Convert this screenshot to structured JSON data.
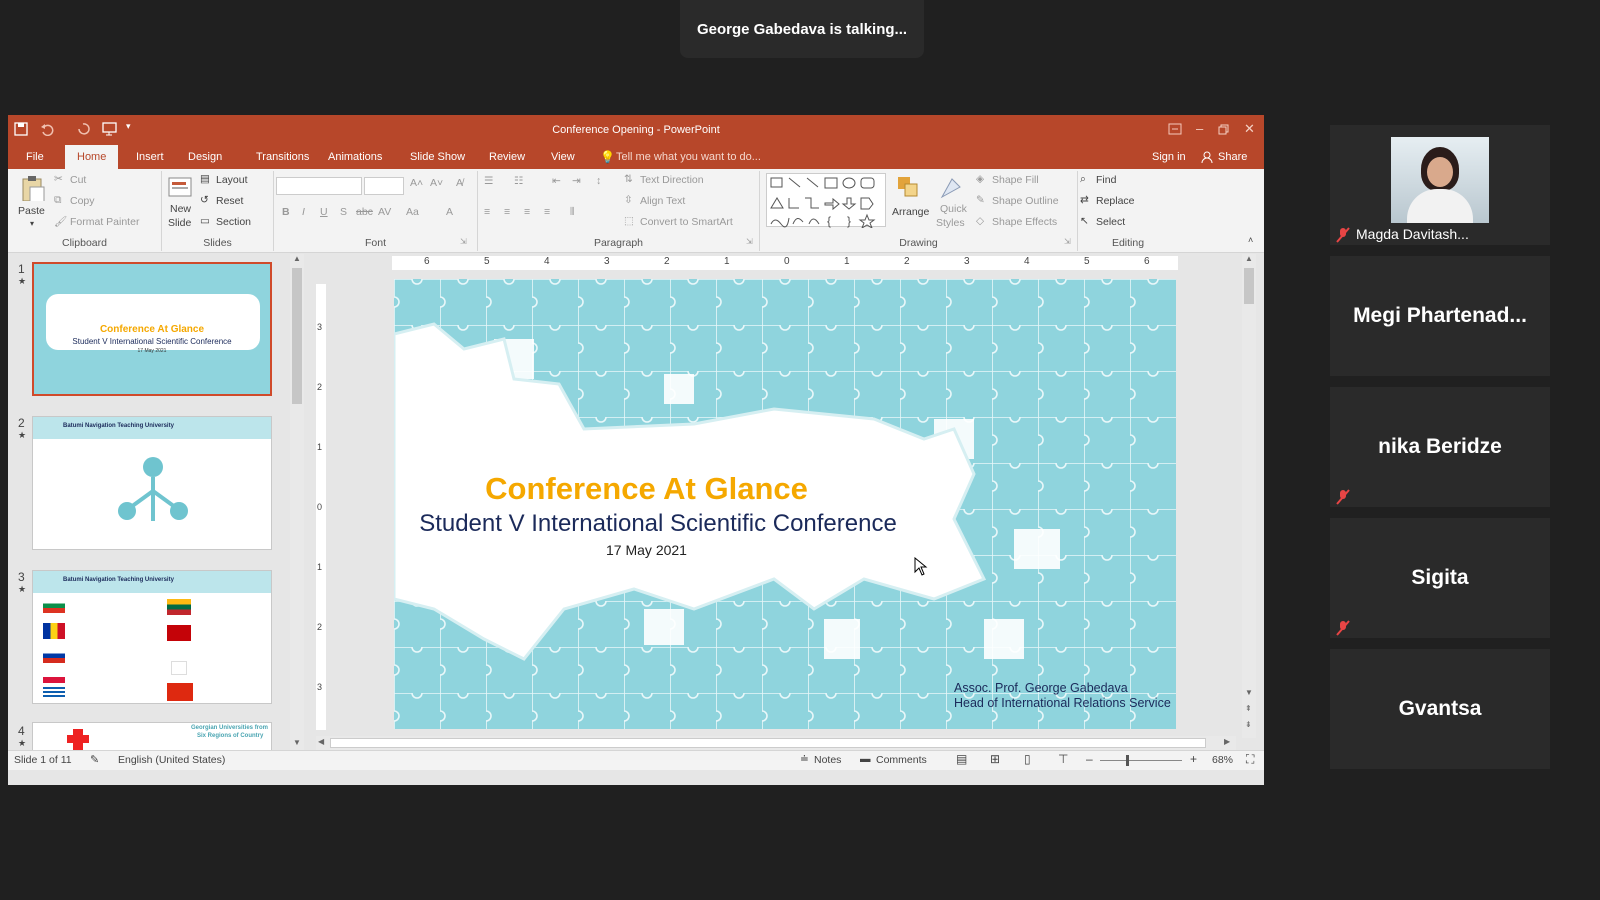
{
  "talking": "George Gabedava is talking...",
  "window": {
    "title": "Conference Opening - PowerPoint",
    "sign_in": "Sign in",
    "share": "Share",
    "tell_me": "Tell me what you want to do..."
  },
  "tabs": [
    "File",
    "Home",
    "Insert",
    "Design",
    "Transitions",
    "Animations",
    "Slide Show",
    "Review",
    "View"
  ],
  "ribbon": {
    "clipboard": {
      "label": "Clipboard",
      "paste": "Paste",
      "cut": "Cut",
      "copy": "Copy",
      "format_painter": "Format Painter"
    },
    "slides": {
      "label": "Slides",
      "new_slide_1": "New",
      "new_slide_2": "Slide",
      "layout": "Layout",
      "reset": "Reset",
      "section": "Section"
    },
    "font": {
      "label": "Font",
      "abc": "abc",
      "av": "AV",
      "aa": "Aa"
    },
    "paragraph": {
      "label": "Paragraph",
      "text_direction": "Text Direction",
      "align_text": "Align Text",
      "convert": "Convert to SmartArt"
    },
    "drawing": {
      "label": "Drawing",
      "arrange": "Arrange",
      "quick_1": "Quick",
      "quick_2": "Styles",
      "shape_fill": "Shape Fill",
      "shape_outline": "Shape Outline",
      "shape_effects": "Shape Effects"
    },
    "editing": {
      "label": "Editing",
      "find": "Find",
      "replace": "Replace",
      "select": "Select"
    }
  },
  "thumbs": {
    "t1_title": "Conference At Glance",
    "t1_sub": "Student V International Scientific Conference",
    "t1_date": "17 May 2021",
    "t2_head": "Batumi Navigation Teaching University",
    "t3_head": "Batumi Navigation Teaching University",
    "t4_head_1": "Georgian Universities from",
    "t4_head_2": "Six Regions of Country",
    "nums": [
      "1",
      "2",
      "3",
      "4"
    ]
  },
  "ruler_labels": [
    "6",
    "5",
    "4",
    "3",
    "2",
    "1",
    "0",
    "1",
    "2",
    "3",
    "4",
    "5",
    "6"
  ],
  "vruler_labels": [
    "3",
    "2",
    "1",
    "0",
    "1",
    "2",
    "3"
  ],
  "slide": {
    "title": "Conference At Glance",
    "subtitle": "Student V International Scientific Conference",
    "date": "17 May 2021",
    "author_1": "Assoc. Prof. George Gabedava",
    "author_2": "Head of International Relations Service",
    "title_color": "#f5a800",
    "bg_color": "#8fd4dd"
  },
  "status": {
    "slide_of": "Slide 1 of 11",
    "language": "English (United States)",
    "notes": "Notes",
    "comments": "Comments",
    "zoom": "68%"
  },
  "participants": [
    {
      "name": "Magda Davitash...",
      "muted": true,
      "has_video": true
    },
    {
      "name": "Megi  Phartenad...",
      "muted": false,
      "has_video": false
    },
    {
      "name": "nika Beridze",
      "muted": true,
      "has_video": false
    },
    {
      "name": "Sigita",
      "muted": true,
      "has_video": false
    },
    {
      "name": "Gvantsa",
      "muted": false,
      "has_video": false
    }
  ]
}
